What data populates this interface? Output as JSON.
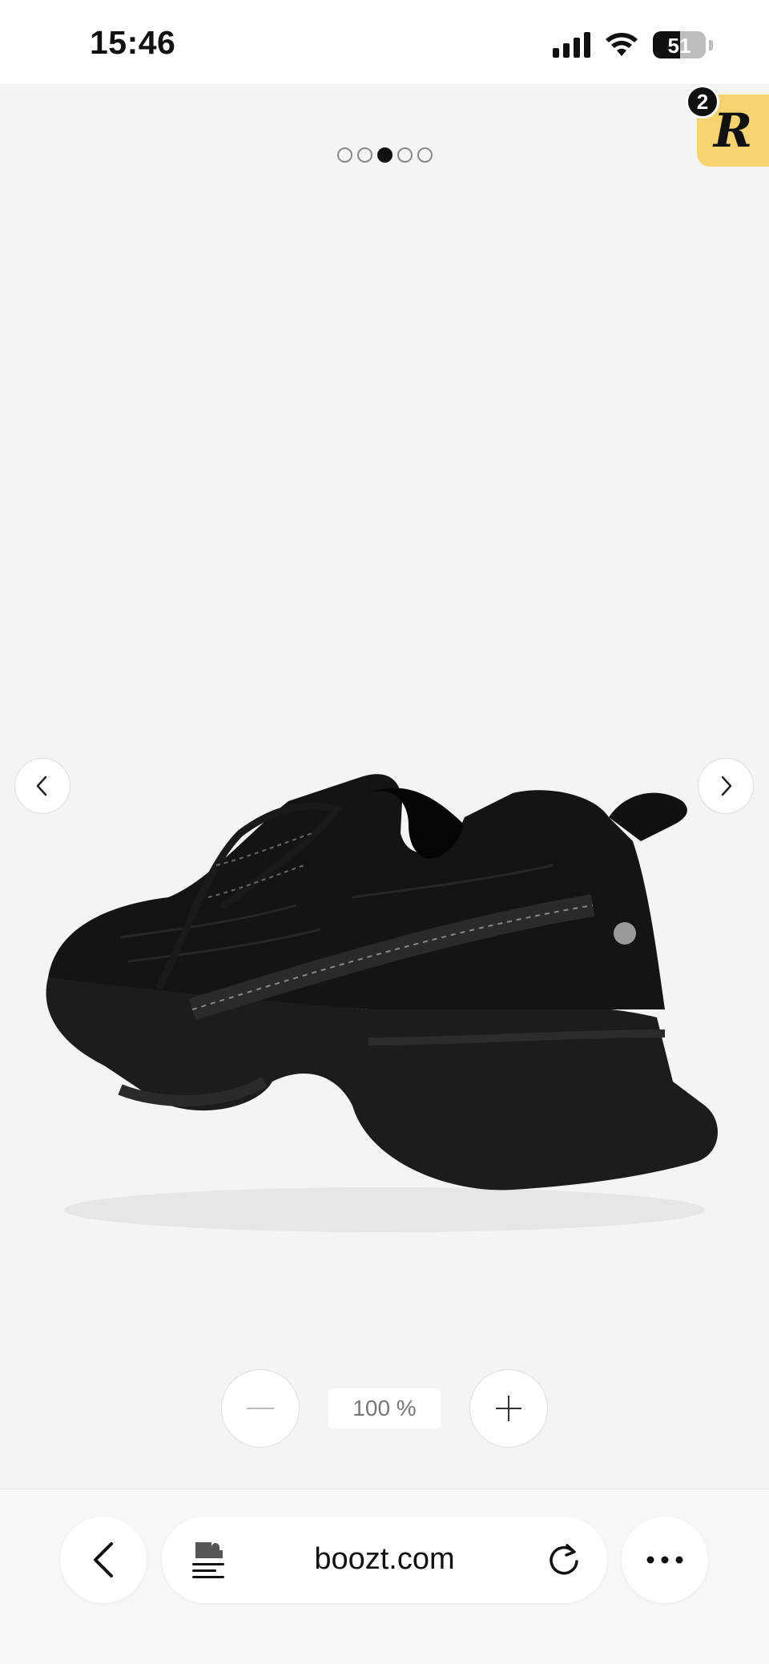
{
  "status_bar": {
    "time": "15:46",
    "battery_percent": "51",
    "battery_level": 0.51,
    "signal_icon": "cellular-signal-icon",
    "wifi_icon": "wifi-icon"
  },
  "gallery": {
    "image_count": 5,
    "active_index": 2,
    "image_alt": "Black knit chunky sneaker",
    "prev_icon": "chevron-left-icon",
    "next_icon": "chevron-right-icon"
  },
  "badge": {
    "letter": "R",
    "count": "2",
    "color": "#f7d36e"
  },
  "zoom": {
    "level": "100 %",
    "minus_icon": "minus-icon",
    "plus_icon": "plus-icon"
  },
  "browser": {
    "url": "boozt.com",
    "back_icon": "back-arrow-icon",
    "reader_icon": "page-extension-icon",
    "reload_icon": "reload-icon",
    "more_icon": "more-dots-icon"
  }
}
